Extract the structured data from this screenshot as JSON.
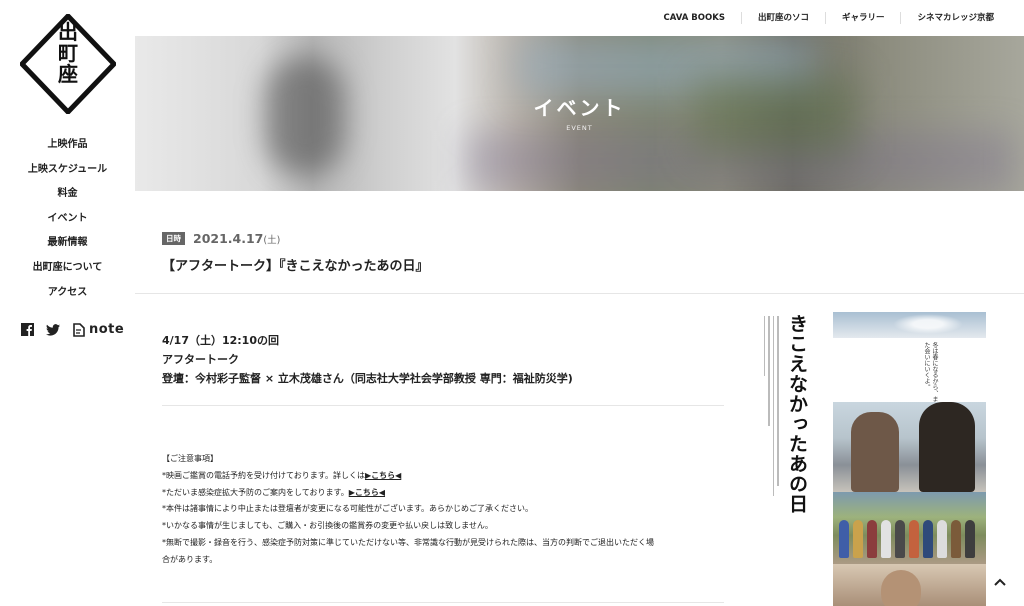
{
  "brand": {
    "logo_text": "出町座"
  },
  "topnav": [
    "CAVA BOOKS",
    "出町座のソコ",
    "ギャラリー",
    "シネマカレッジ京都"
  ],
  "sidebar": {
    "nav": [
      "上映作品",
      "上映スケジュール",
      "料金",
      "イベント",
      "最新情報",
      "出町座について",
      "アクセス"
    ],
    "social": {
      "facebook_icon": "facebook-icon",
      "twitter_icon": "twitter-icon",
      "note_label": "note"
    }
  },
  "hero": {
    "title": "イベント",
    "subtitle": "EVENT"
  },
  "event": {
    "date_label": "日時",
    "date": "2021.4.17",
    "dow": "(土)",
    "title": "【アフタートーク】『きこえなかったあの日』"
  },
  "details": {
    "line1": "4/17（土）12:10の回",
    "line2": "アフタートーク",
    "line3": "登壇：今村彩子監督 × 立木茂雄さん（同志社大学社会学部教授 専門：福祉防災学)"
  },
  "notice": {
    "heading": "【ご注意事項】",
    "l1_pre": "*映画ご鑑賞の電話予約を受け付けております。詳しくは",
    "l1_link": "▶こちら◀",
    "l2_pre": "*ただいま感染症拡大予防のご案内をしております。",
    "l2_link": "▶こちら◀",
    "l3": "*本件は諸事情により中止または登壇者が変更になる可能性がございます。あらかじめご了承ください。",
    "l4": "*いかなる事情が生じましても、ご購入・お引換後の鑑賞券の変更や払い戻しは致しません。",
    "l5": "*無断で撮影・録音を行う、感染症予防対策に準じていただけない等、非常識な行動が見受けられた際は、当方の判断でご退出いただく場",
    "l6": "合があります。"
  },
  "poster": {
    "title": "きこえなかったあの日",
    "slogan": "冬は春になるから、また会いにいくよ。"
  },
  "colors": {
    "text": "#222222",
    "muted": "#666666",
    "divider": "#e6e6e6"
  }
}
